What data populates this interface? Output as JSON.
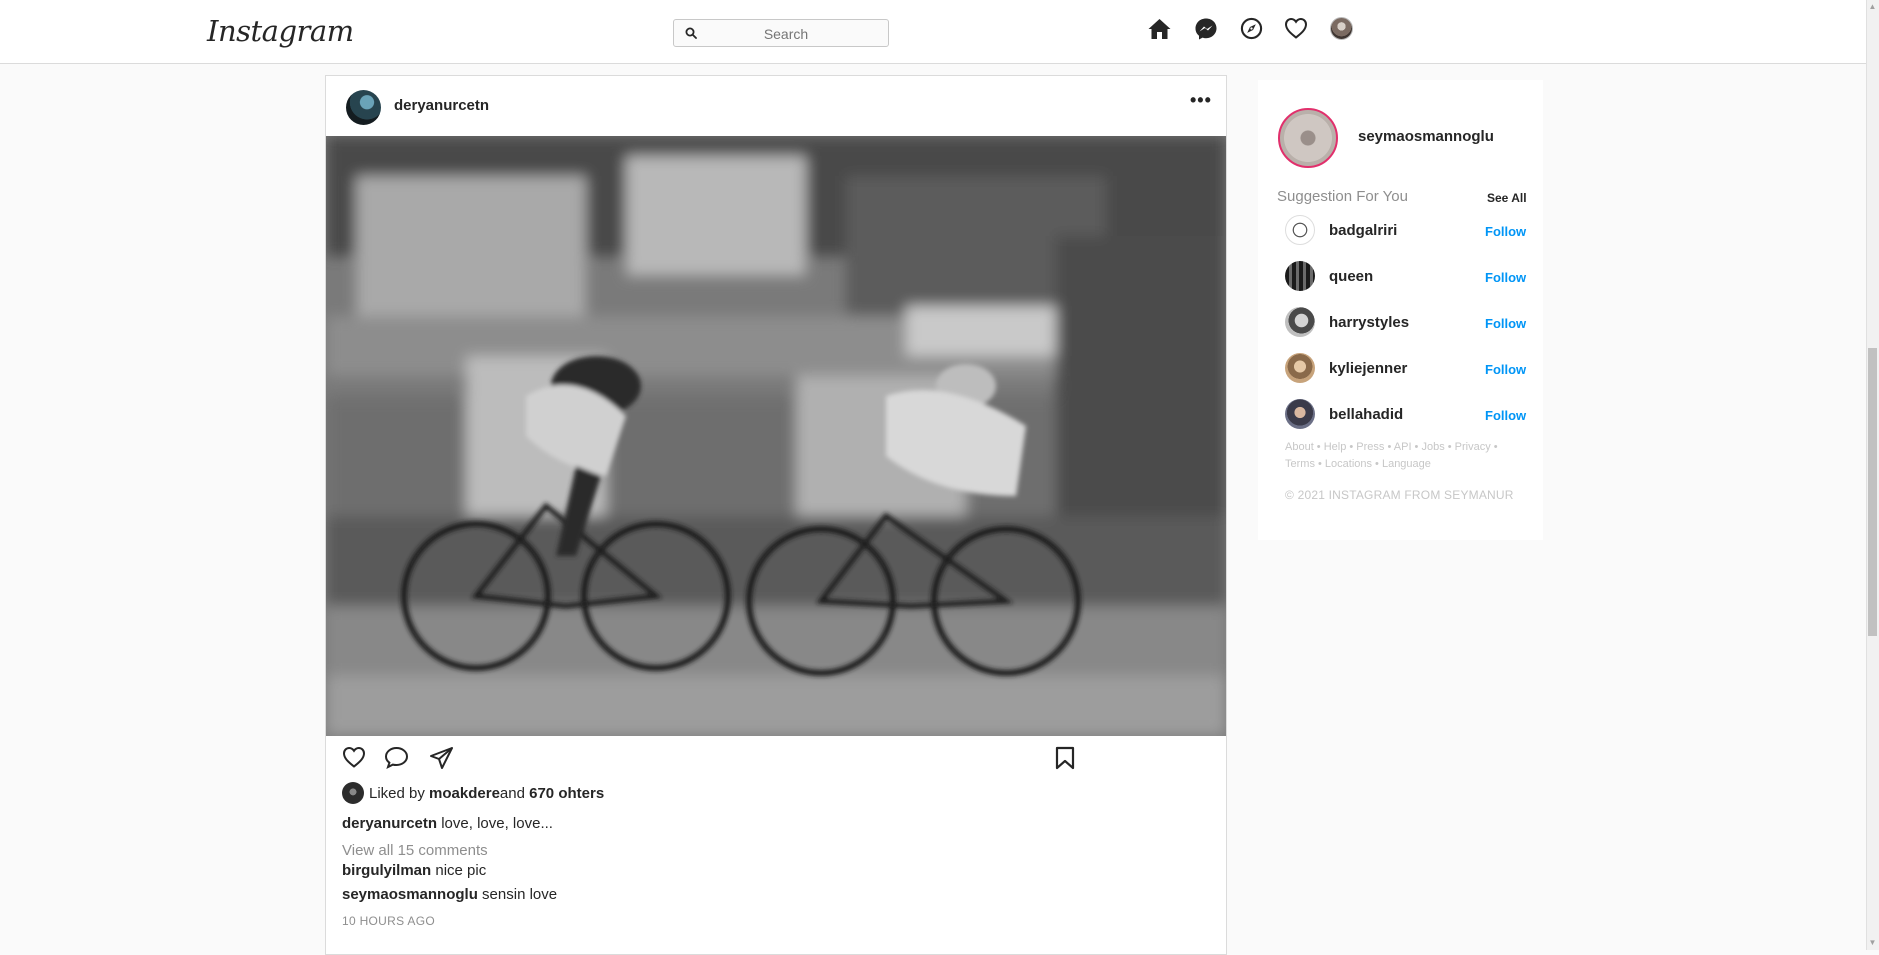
{
  "topbar": {
    "logo": "Instagram",
    "search_placeholder": "Search",
    "icons": [
      "home-icon",
      "messenger-icon",
      "explore-icon",
      "heart-icon",
      "avatar"
    ]
  },
  "post": {
    "username": "deryanurcetn",
    "more_label": "•••",
    "liked_by_prefix": "Liked by",
    "liked_by_user": "moakdere",
    "liked_by_and": "and",
    "liked_by_count": "670 ohters",
    "caption_user": "deryanurcetn",
    "caption_text": "love, love, love...",
    "view_all": "View all 15 comments",
    "comments": [
      {
        "user": "birgulyilman",
        "text": "nice pic"
      },
      {
        "user": "seymaosmannoglu",
        "text": "sensin love"
      }
    ],
    "timestamp": "10 HOURS AGO"
  },
  "sidebar": {
    "me": "seymaosmannoglu",
    "suggestion_title": "Suggestion For You",
    "see_all": "See All",
    "follow_label": "Follow",
    "suggestions": [
      {
        "name": "badgalriri"
      },
      {
        "name": "queen"
      },
      {
        "name": "harrystyles"
      },
      {
        "name": "kyliejenner"
      },
      {
        "name": "bellahadid"
      }
    ],
    "footer_line1": "About • Help • Press • API • Jobs • Privacy •",
    "footer_line2": "Terms • Locations • Language",
    "copyright": "© 2021 INSTAGRAM FROM SEYMANUR"
  },
  "colors": {
    "accent_blue": "#0095f6",
    "story_ring": "#e1306c",
    "border": "#dbdbdb"
  }
}
